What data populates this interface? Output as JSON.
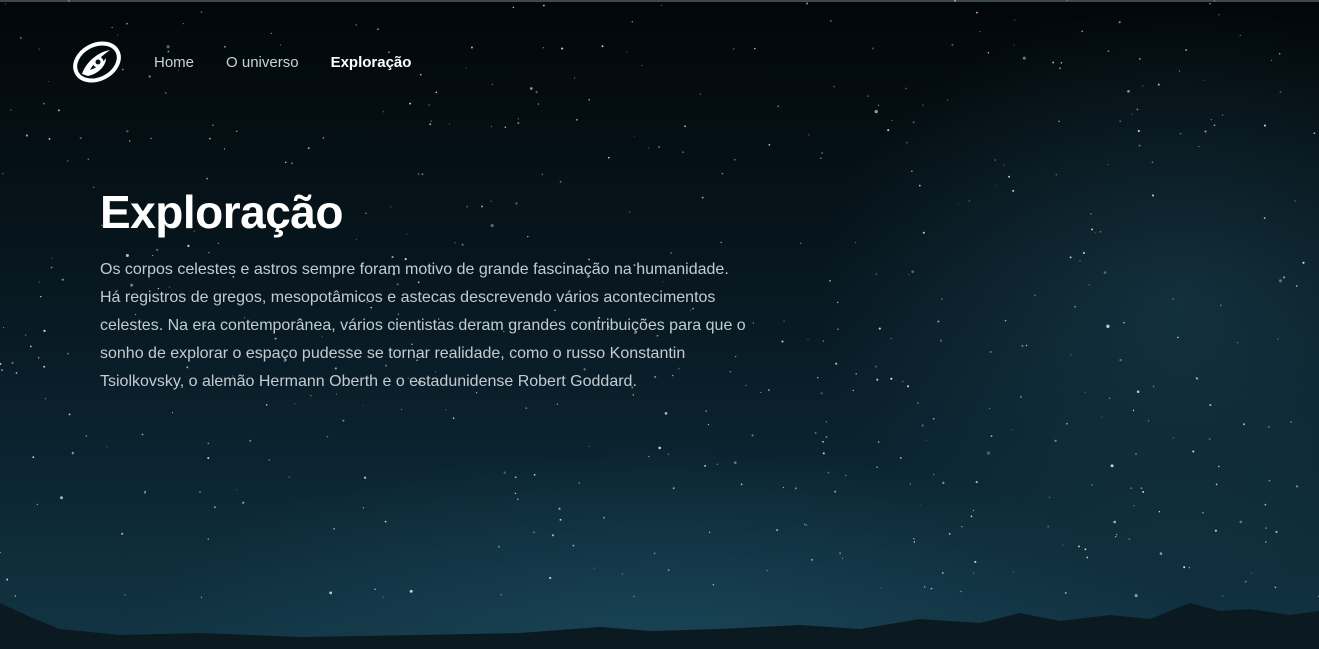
{
  "nav": {
    "logo_icon": "swirl-logo-icon",
    "items": [
      {
        "label": "Home",
        "active": false
      },
      {
        "label": "O universo",
        "active": false
      },
      {
        "label": "Exploração",
        "active": true
      }
    ]
  },
  "hero": {
    "title": "Exploração",
    "paragraph": "Os corpos celestes e astros sempre foram motivo de grande fascinação na humanidade. Há registros de gregos, mesopotâmicos e astecas descrevendo vários acontecimentos celestes. Na era contemporânea, vários cientistas deram grandes contribuições para que o sonho de explorar o espaço pudesse se tornar realidade, como o russo Konstantin Tsiolkovsky, o alemão Hermann Oberth e o estadunidense Robert Goddard."
  },
  "colors": {
    "background_dark": "#05141c",
    "background_teal": "#123544",
    "text_primary": "#ffffff",
    "text_secondary": "#c3ccd0"
  }
}
